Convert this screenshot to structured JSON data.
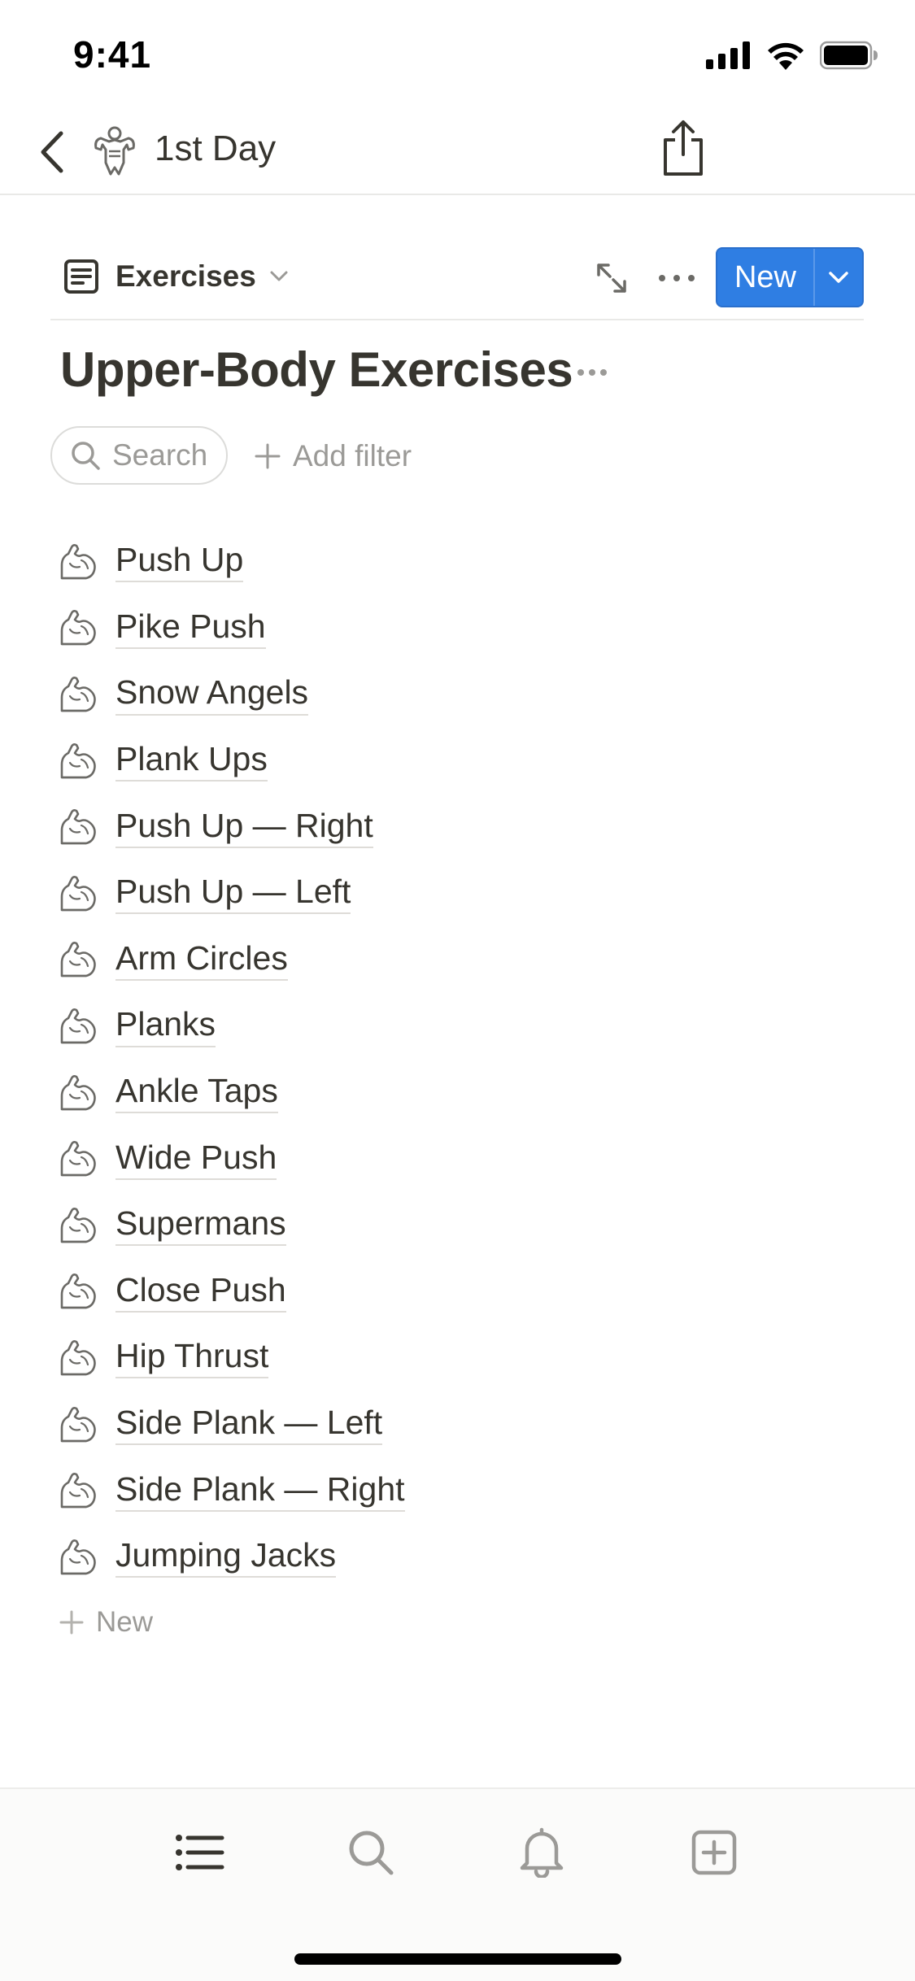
{
  "status_bar": {
    "time": "9:41"
  },
  "nav": {
    "title": "1st Day",
    "page_icon": "muscle-figure-icon"
  },
  "toolbar": {
    "view_label": "Exercises",
    "new_label": "New"
  },
  "database": {
    "title": "Upper-Body Exercises",
    "search_label": "Search",
    "add_filter_label": "Add filter",
    "items": [
      "Push Up",
      "Pike Push",
      "Snow Angels",
      "Plank Ups",
      "Push Up — Right",
      "Push Up — Left",
      "Arm Circles",
      "Planks",
      "Ankle Taps",
      "Wide Push",
      "Supermans",
      "Close Push",
      "Hip Thrust",
      "Side Plank — Left",
      "Side Plank — Right",
      "Jumping Jacks"
    ],
    "new_row_label": "New"
  },
  "tab_bar": {
    "tabs": [
      "list-icon",
      "search-icon",
      "bell-icon",
      "add-page-icon"
    ]
  },
  "colors": {
    "accent": "#2f7ee3",
    "text": "#37352f",
    "muted": "#9b9a97",
    "divider": "#e9e9e7"
  }
}
